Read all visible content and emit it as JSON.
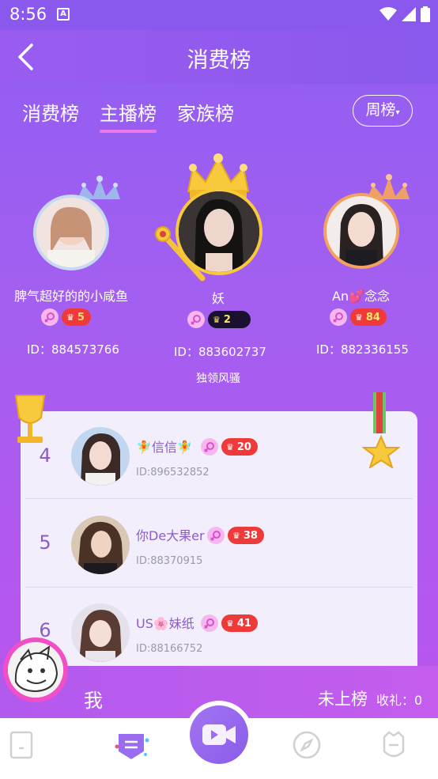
{
  "status_bar": {
    "time": "8:56",
    "a_badge": "A"
  },
  "app_bar": {
    "title": "消费榜"
  },
  "tabs": [
    {
      "label": "消费榜",
      "active": false
    },
    {
      "label": "主播榜",
      "active": true
    },
    {
      "label": "家族榜",
      "active": false
    }
  ],
  "period": {
    "label": "周榜"
  },
  "podium": {
    "first": {
      "name": "妖",
      "level": "2",
      "id": "ID：883602737",
      "motto": "独领风骚"
    },
    "second": {
      "name": "脾气超好的的小咸鱼",
      "level": "5",
      "id": "ID：884573766"
    },
    "third": {
      "name": "An💕念念",
      "level": "84",
      "id": "ID：882336155"
    }
  },
  "list": [
    {
      "rank": "4",
      "name": "🧚信信🧚",
      "level": "20",
      "id": "ID:896532852"
    },
    {
      "rank": "5",
      "name": "你De大果er",
      "level": "38",
      "id": "ID:88370915"
    },
    {
      "rank": "6",
      "name": "US🌸妹纸",
      "level": "41",
      "id": "ID:88166752"
    }
  ],
  "me": {
    "label": "我",
    "status": "未上榜",
    "gift_label": "收礼：0"
  },
  "colors": {
    "accent": "#8b5cf6",
    "level_red": "#f03a3a",
    "gender_pink": "#f6b6ee"
  },
  "icons": [
    "back-arrow-icon",
    "wifi-icon",
    "signal-icon",
    "battery-icon",
    "crown-icon",
    "medal-icon",
    "trophy-icon"
  ]
}
